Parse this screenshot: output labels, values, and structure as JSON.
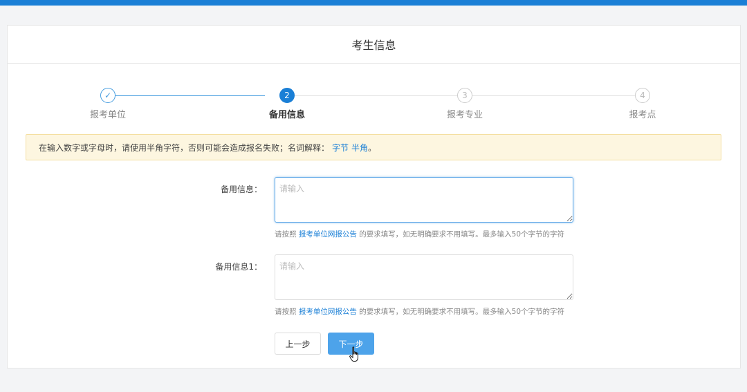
{
  "header": {
    "title": "考生信息"
  },
  "steps": [
    {
      "label": "报考单位",
      "marker": "✓",
      "state": "done"
    },
    {
      "label": "备用信息",
      "marker": "2",
      "state": "active"
    },
    {
      "label": "报考专业",
      "marker": "3",
      "state": "pending"
    },
    {
      "label": "报考点",
      "marker": "4",
      "state": "pending"
    }
  ],
  "alert": {
    "text": "在输入数字或字母时，请使用半角字符，否则可能会造成报名失败；名词解释：",
    "link1": "字节",
    "link2": "半角",
    "end": "。"
  },
  "fields": [
    {
      "label": "备用信息：",
      "value": "",
      "placeholder": "请输入",
      "hint_prefix": "请按照",
      "hint_link": "报考单位网报公告",
      "hint_suffix": "的要求填写，如无明确要求不用填写。最多输入50个字节的字符"
    },
    {
      "label": "备用信息1：",
      "value": "",
      "placeholder": "请输入",
      "hint_prefix": "请按照",
      "hint_link": "报考单位网报公告",
      "hint_suffix": "的要求填写，如无明确要求不用填写。最多输入50个字节的字符"
    }
  ],
  "buttons": {
    "prev": "上一步",
    "next": "下一步"
  },
  "colors": {
    "accent": "#1a7fd6",
    "alert_bg": "#fdf6e0",
    "next_button": "#4da3ea"
  },
  "icons": {
    "cursor": "hand-pointer-icon",
    "done_step": "check-icon"
  }
}
